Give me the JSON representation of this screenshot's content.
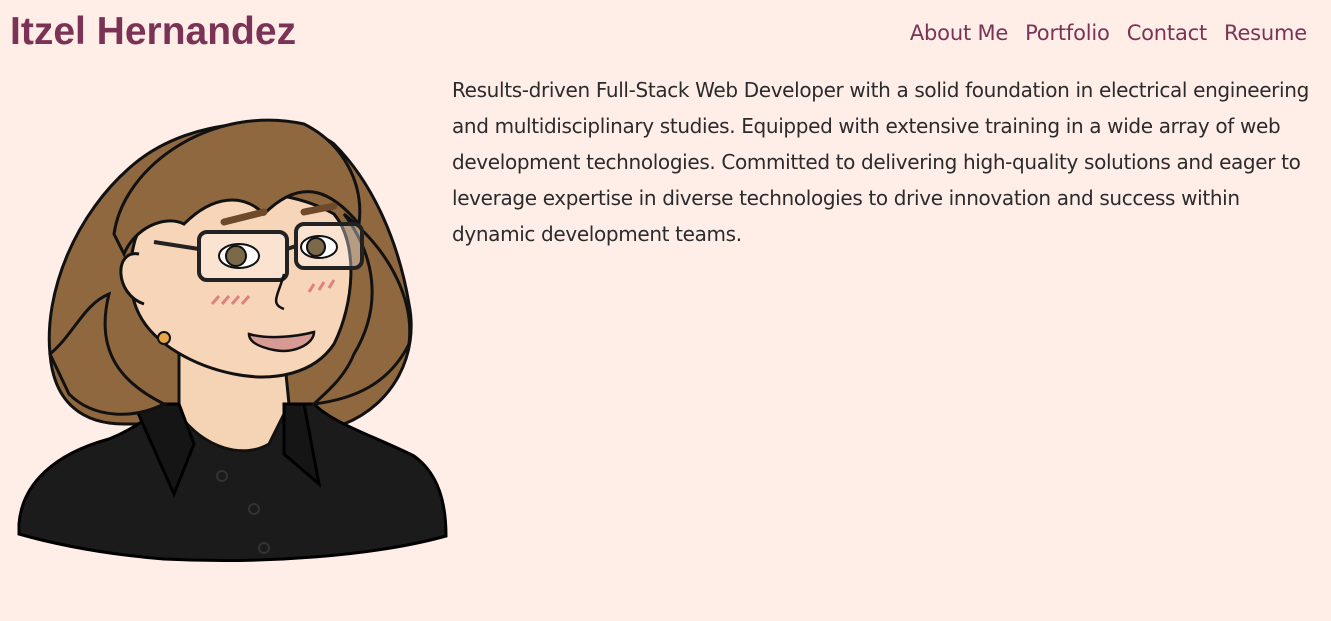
{
  "header": {
    "title": "Itzel Hernandez",
    "nav": [
      {
        "label": "About Me"
      },
      {
        "label": "Portfolio"
      },
      {
        "label": "Contact"
      },
      {
        "label": "Resume"
      }
    ]
  },
  "about": {
    "bio": "Results-driven Full-Stack Web Developer with a solid foundation in electrical engineering and multidisciplinary studies. Equipped with extensive training in a wide array of web development technologies. Committed to delivering high-quality solutions and eager to leverage expertise in diverse technologies to drive innovation and success within dynamic development teams."
  },
  "colors": {
    "background": "#FFEDE8",
    "accent": "#7B3355",
    "text": "#2B2B2B"
  }
}
